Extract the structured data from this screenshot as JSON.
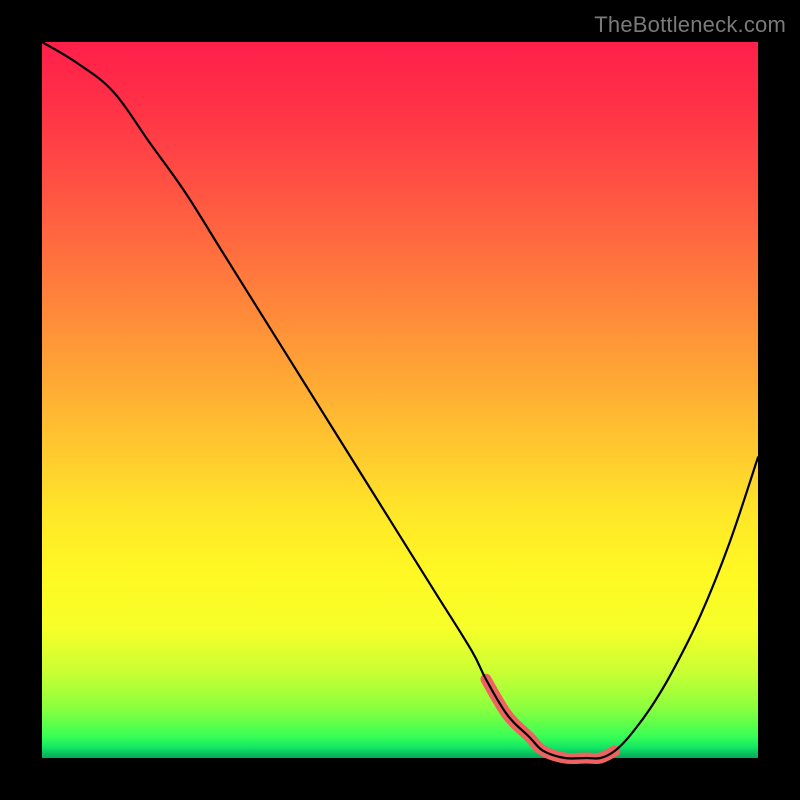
{
  "watermark": "TheBottleneck.com",
  "chart_data": {
    "type": "line",
    "title": "",
    "xlabel": "",
    "ylabel": "",
    "xlim": [
      0,
      100
    ],
    "ylim": [
      0,
      100
    ],
    "grid": false,
    "series": [
      {
        "name": "bottleneck-curve",
        "x": [
          0,
          5,
          10,
          15,
          20,
          25,
          30,
          35,
          40,
          45,
          50,
          55,
          60,
          62,
          65,
          68,
          70,
          73,
          76,
          78,
          80,
          82,
          85,
          88,
          92,
          96,
          100
        ],
        "y": [
          100,
          97,
          93,
          86,
          79,
          71,
          63,
          55,
          47,
          39,
          31,
          23,
          15,
          11,
          6,
          3,
          1,
          0,
          0,
          0,
          1,
          3,
          7,
          12,
          20,
          30,
          42
        ]
      },
      {
        "name": "optimal-range-highlight",
        "x": [
          62,
          65,
          68,
          70,
          73,
          76,
          78,
          80
        ],
        "y": [
          11,
          6,
          3,
          1,
          0,
          0,
          0,
          1
        ]
      }
    ],
    "colors": {
      "curve": "#000000",
      "highlight": "#ef6262"
    }
  }
}
